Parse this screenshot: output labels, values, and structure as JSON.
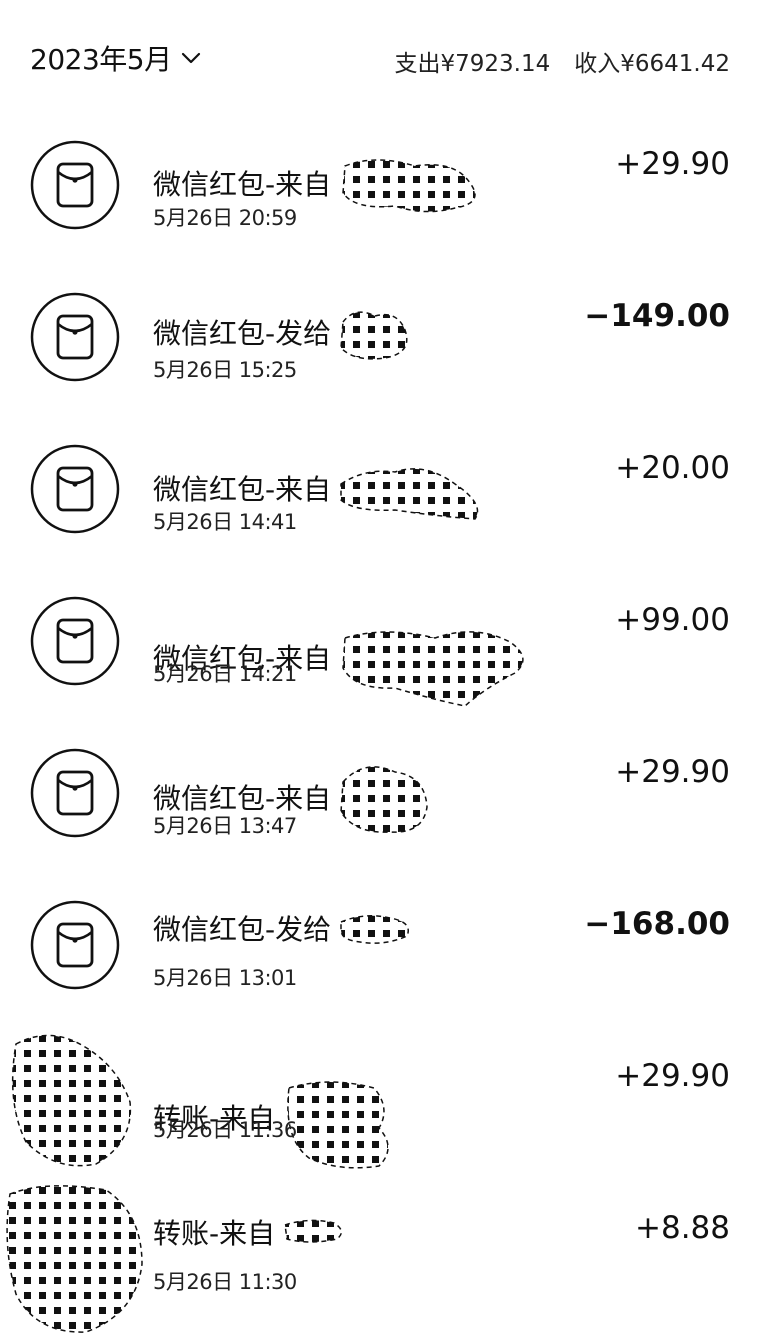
{
  "header": {
    "month": "2023年5月",
    "expense_label": "支出¥7923.14",
    "income_label": "收入¥6641.42"
  },
  "transactions": [
    {
      "title": "微信红包-来自",
      "time": "5月26日  20:59",
      "amount": "+29.90",
      "type": "in",
      "icon": "red-packet-icon"
    },
    {
      "title": "微信红包-发给",
      "time": "5月26日  15:25",
      "amount": "−149.00",
      "type": "out",
      "icon": "red-packet-icon"
    },
    {
      "title": "微信红包-来自",
      "time": "5月26日  14:41",
      "amount": "+20.00",
      "type": "in",
      "icon": "red-packet-icon"
    },
    {
      "title": "微信红包-来自",
      "time": "5月26日  14:21",
      "amount": "+99.00",
      "type": "in",
      "icon": "red-packet-icon"
    },
    {
      "title": "微信红包-来自",
      "time": "5月26日  13:47",
      "amount": "+29.90",
      "type": "in",
      "icon": "red-packet-icon"
    },
    {
      "title": "微信红包-发给",
      "time": "5月26日  13:01",
      "amount": "−168.00",
      "type": "out",
      "icon": "red-packet-icon"
    },
    {
      "title": "转账-来自",
      "time": "5月26日  11:36",
      "amount": "+29.90",
      "type": "in",
      "icon": "redacted-avatar"
    },
    {
      "title": "转账-来自",
      "time": "5月26日  11:30",
      "amount": "+8.88",
      "type": "in",
      "icon": "redacted-avatar"
    }
  ]
}
